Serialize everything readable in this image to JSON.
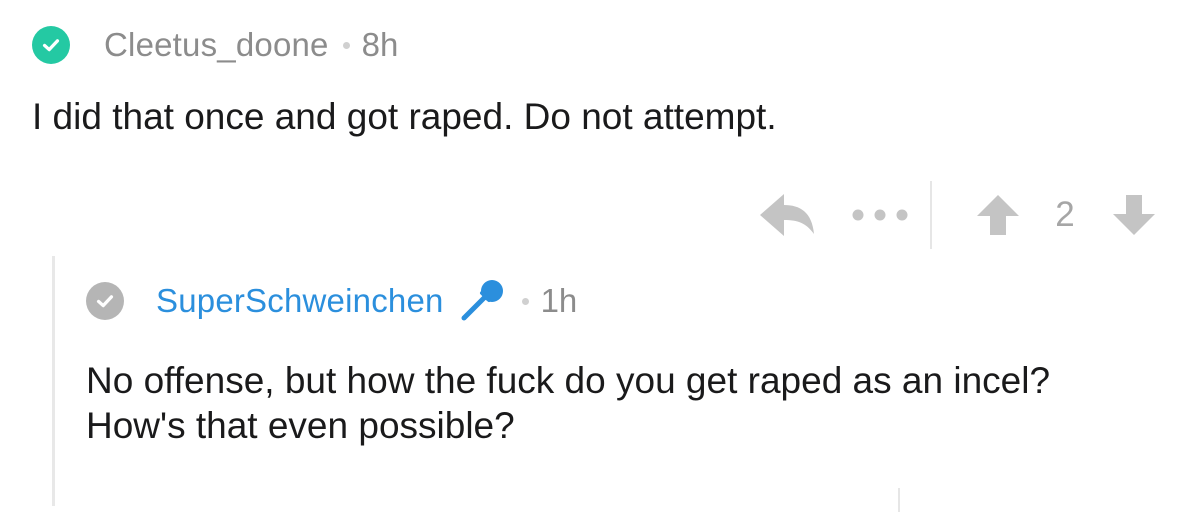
{
  "comment": {
    "author": "Cleetus_doone",
    "time": "8h",
    "body": "I did that once and got raped. Do not attempt.",
    "avatar_icon": "checkmark-icon",
    "avatar_color": "#24c9a3",
    "actions": {
      "reply_icon": "reply-arrow-icon",
      "more_icon": "more-dots-icon",
      "upvote_icon": "upvote-arrow-icon",
      "score": "2",
      "downvote_icon": "downvote-arrow-icon"
    }
  },
  "reply": {
    "author": "SuperSchweinchen",
    "time": "1h",
    "body": "No offense, but how the fuck do you get raped as an incel? How's that even possible?",
    "avatar_icon": "checkmark-icon",
    "avatar_color": "#b5b5b5",
    "author_color": "#2b8fdd",
    "flair_icon": "microphone-icon"
  }
}
